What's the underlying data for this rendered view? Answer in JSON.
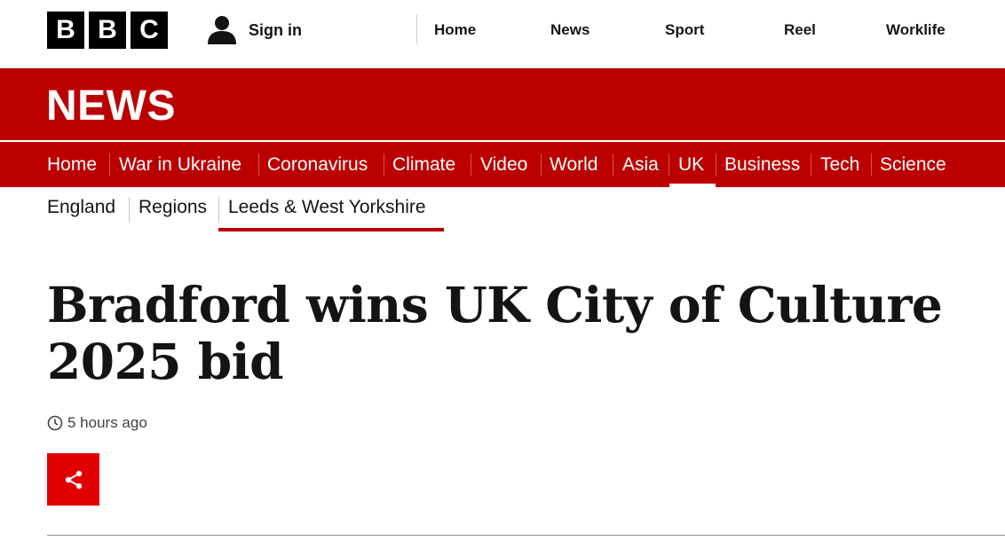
{
  "brand": {
    "logo_letters": [
      "B",
      "B",
      "C"
    ],
    "section_title": "NEWS",
    "colors": {
      "brand_red": "#bb0000",
      "share_red": "#e00000",
      "text": "#141414"
    }
  },
  "header": {
    "signin_label": "Sign in",
    "signin_icon": "user-icon",
    "nav": [
      "Home",
      "News",
      "Sport",
      "Reel",
      "Worklife"
    ]
  },
  "main_nav": {
    "items": [
      "Home",
      "War in Ukraine",
      "Coronavirus",
      "Climate",
      "Video",
      "World",
      "Asia",
      "UK",
      "Business",
      "Tech",
      "Science"
    ],
    "active": "UK"
  },
  "sub_nav": {
    "items": [
      "England",
      "Regions",
      "Leeds & West Yorkshire"
    ],
    "active": "Leeds & West Yorkshire"
  },
  "article": {
    "headline": "Bradford wins UK City of Culture 2025 bid",
    "timestamp": "5 hours ago",
    "timestamp_icon": "clock-icon",
    "share_icon": "share-icon"
  }
}
